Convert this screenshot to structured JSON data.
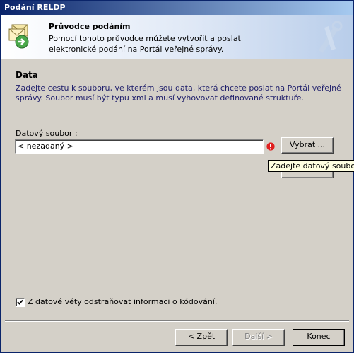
{
  "window": {
    "title": "Podání RELDP"
  },
  "header": {
    "title": "Průvodce podáním",
    "description": "Pomocí tohoto průvodce můžete vytvořit a poslat elektronické podání na Portál veřejné správy."
  },
  "section": {
    "title": "Data",
    "description": "Zadejte cestu k souboru, ve kterém jsou data, která chcete poslat na Portál veřejné správy. Soubor musí být typu xml a musí vyhovovat definované struktuře."
  },
  "file_field": {
    "label": "Datový soubor :",
    "value": "< nezadaný >",
    "browse_label": "Vybrat ...",
    "error_tooltip": "Zadejte datový soubor."
  },
  "option": {
    "checked": true,
    "label": "Z datové věty odstraňovat informaci o kódování."
  },
  "footer": {
    "back_label": "< Zpět",
    "next_label": "Další >",
    "end_label": "Konec"
  },
  "colors": {
    "titlebar_start": "#0a246a",
    "titlebar_end": "#a6caf0",
    "error": "#e02020",
    "tooltip_bg": "#ffffe1"
  },
  "icons": {
    "header": "envelope-wizard-icon",
    "watermark": "tools-watermark-icon",
    "error": "error-exclamation-icon",
    "check": "checkmark-icon"
  }
}
